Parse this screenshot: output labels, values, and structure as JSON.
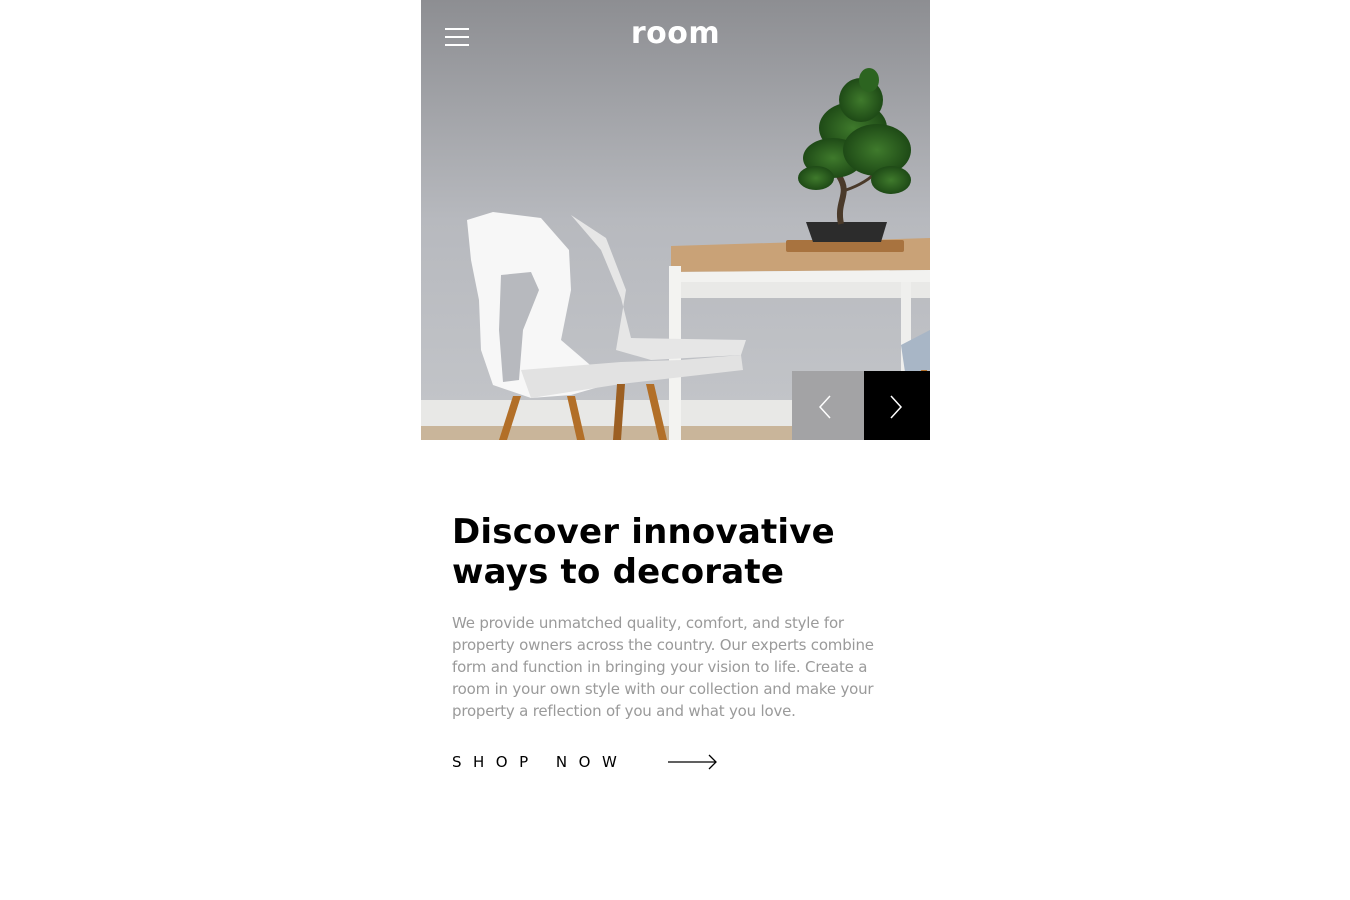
{
  "header": {
    "logo_text": "room",
    "menu_icon": "hamburger-menu-icon"
  },
  "hero": {
    "image_description_icon": "hero-photo",
    "prev_icon": "chevron-left-icon",
    "next_icon": "chevron-right-icon",
    "colors": {
      "prev_bg": "#a3a3a5",
      "next_bg": "#000000"
    }
  },
  "main": {
    "headline_line1": "Discover innovative",
    "headline_line2": "ways to decorate",
    "description": "We provide unmatched quality, comfort, and style for property owners across the country. Our experts combine form and function in bringing your vision to life. Create a room in your own style with our collection and make your property a reflection of you and what you love.",
    "cta_label": "SHOP NOW",
    "cta_icon": "arrow-right-icon"
  }
}
